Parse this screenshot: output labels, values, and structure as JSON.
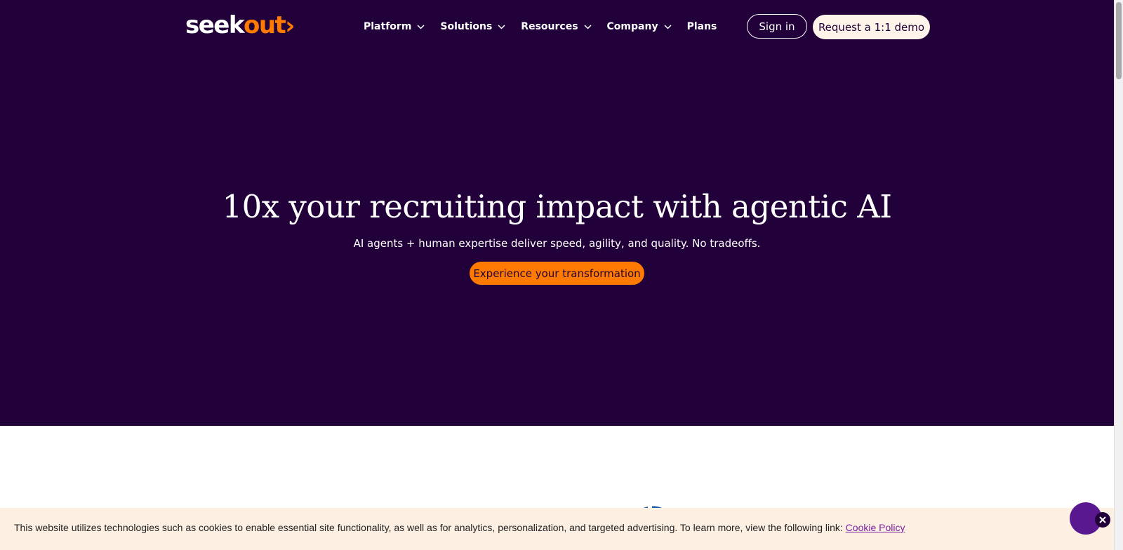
{
  "header": {
    "logo": {
      "part1": "seek",
      "part2": "out",
      "part3": "›",
      "accent_color": "#ff7a00"
    },
    "nav": [
      {
        "label": "Platform",
        "has_dropdown": true,
        "icon": "chevron-down-icon"
      },
      {
        "label": "Solutions",
        "has_dropdown": true,
        "icon": "chevron-down-icon"
      },
      {
        "label": "Resources",
        "has_dropdown": true,
        "icon": "chevron-down-icon"
      },
      {
        "label": "Company",
        "has_dropdown": true,
        "icon": "chevron-down-icon"
      },
      {
        "label": "Plans",
        "has_dropdown": false
      }
    ],
    "sign_in": "Sign in",
    "demo": "Request a 1:1 demo"
  },
  "hero": {
    "title": "10x your recruiting impact with agentic AI",
    "subtitle": "AI agents + human expertise deliver speed, agility, and quality. No tradeoffs.",
    "cta": "Experience your transformation",
    "background_color": "#22003a",
    "cta_color": "#ff7a00"
  },
  "cookie_banner": {
    "text": "This website utilizes technologies such as cookies to enable essential site functionality, as well as for analytics, personalization, and targeted advertising. To learn more, view the following link: ",
    "link": "Cookie Policy",
    "close_icon": "close-icon"
  },
  "chat": {
    "icon": "chat-bubble-icon"
  }
}
